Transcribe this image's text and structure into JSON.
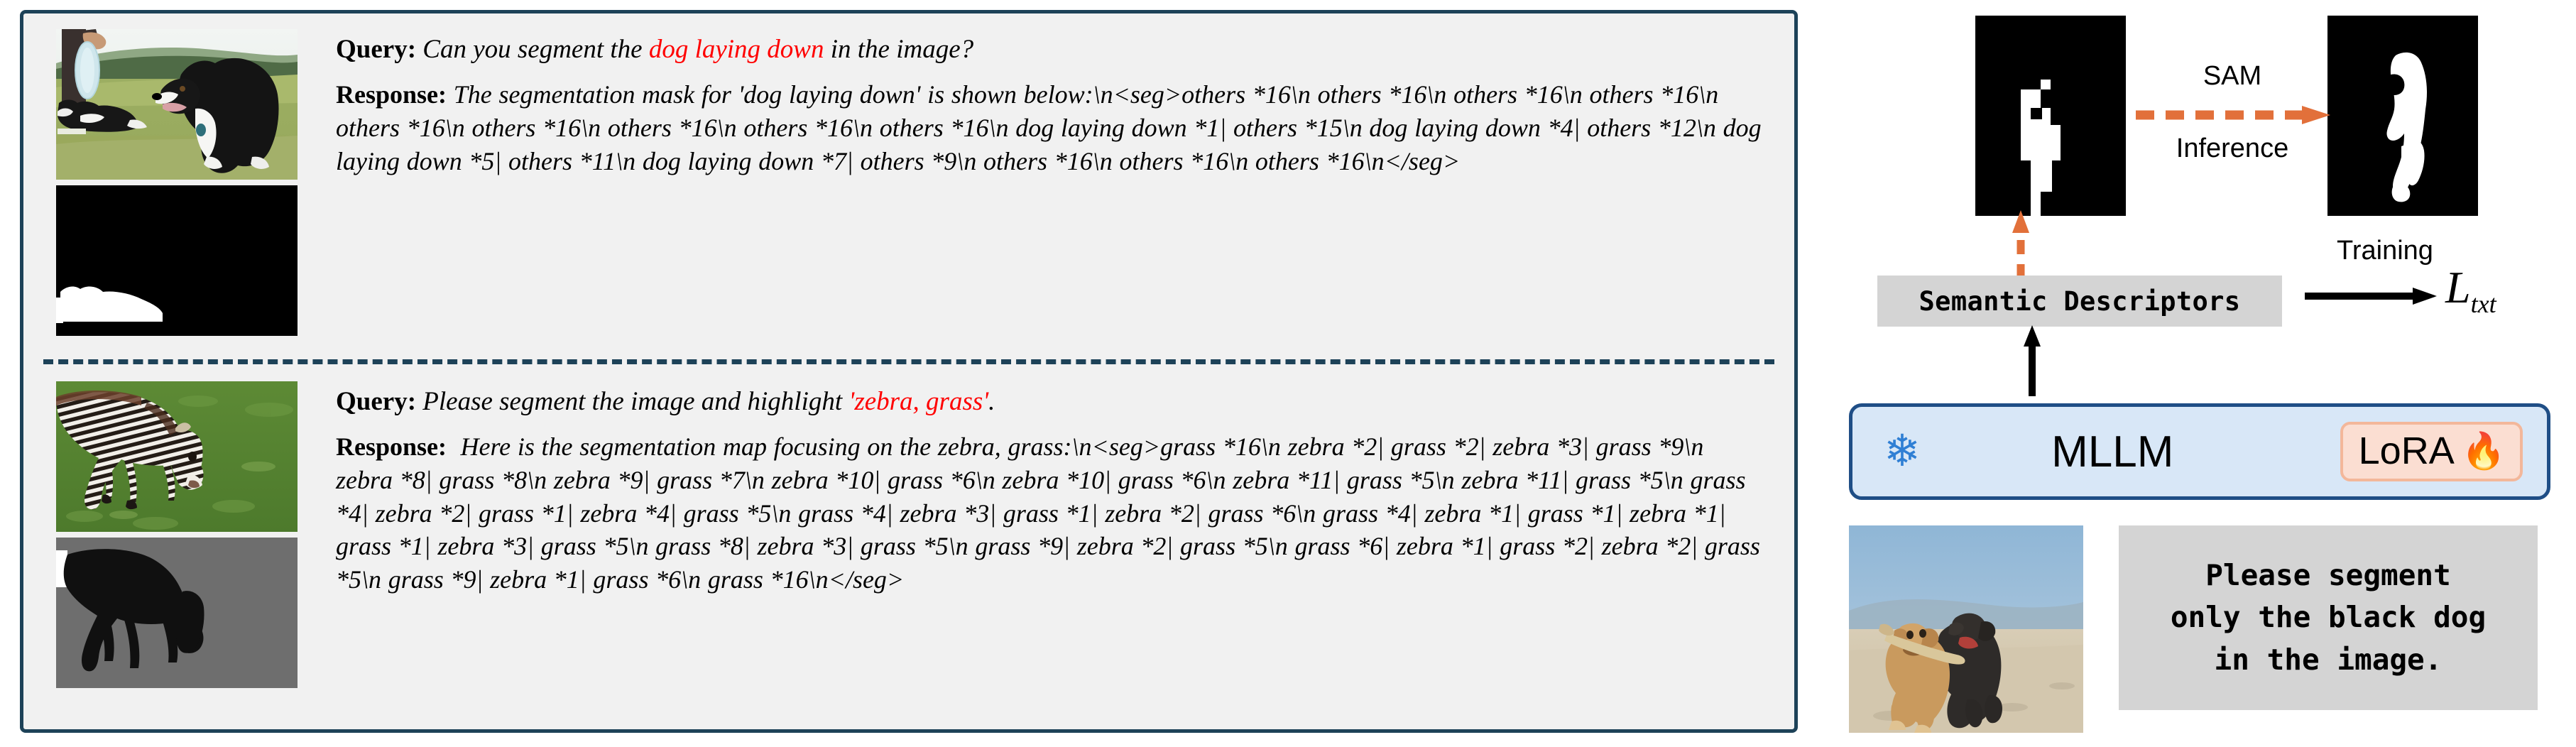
{
  "examples": [
    {
      "query_label": "Query",
      "query_prefix": "Can you segment the ",
      "query_highlight": "dog laying down",
      "query_suffix": " in the image?",
      "response_label": "Response",
      "response_text": "The segmentation mask for 'dog laying down' is shown below:\\n<seg>others *16\\n others *16\\n others *16\\n others *16\\n others *16\\n others *16\\n others *16\\n others *16\\n others *16\\n dog laying down *1| others *15\\n dog laying down *4| others *12\\n dog laying down *5| others *11\\n dog laying down *7| others *9\\n others *16\\n others *16\\n others *16\\n</seg>",
      "photo_alt": "border-collie-with-frisbee-photo",
      "mask_alt": "binary-mask-dog-laying-down"
    },
    {
      "query_label": "Query",
      "query_prefix": "Please segment the image and highlight ",
      "query_highlight": "'zebra, grass'",
      "query_suffix": ".",
      "response_label": "Response",
      "response_text": "Here is the segmentation map focusing on the zebra, grass:\\n<seg>grass *16\\n zebra *2| grass *2| zebra *3| grass *9\\n zebra *8| grass *8\\n zebra *9| grass *7\\n zebra *10| grass *6\\n zebra *10| grass *6\\n zebra *11| grass *5\\n zebra *11| grass *5\\n grass *4| zebra *2| grass *1| zebra *4| grass *5\\n grass *4| zebra *3| grass *1| zebra *2| grass *6\\n grass *4| zebra *1| grass *1| zebra *1| grass *1| zebra *3| grass *5\\n grass *8| zebra *3| grass *5\\n grass *9| zebra *2| grass *5\\n grass *6| zebra *1| grass *2| zebra *2| grass *5\\n grass *9| zebra *1| grass *6\\n grass *16\\n</seg>",
      "photo_alt": "zebra-grazing-photo",
      "mask_alt": "semantic-mask-zebra-grass"
    }
  ],
  "pipeline": {
    "sam_label": "SAM",
    "inference_label": "Inference",
    "training_label": "Training",
    "loss_symbol": "L",
    "loss_subscript": "txt",
    "semantic_descriptors_label": "Semantic Descriptors",
    "mllm_label": "MLLM",
    "lora_label": "LoRA",
    "snowflake_icon": "snowflake-icon",
    "fire_icon": "fire-icon",
    "prompt_text": "Please segment\nonly the black dog\nin the image.",
    "coarse_mask_alt": "coarse-token-mask",
    "sam_mask_alt": "refined-sam-mask",
    "input_photo_alt": "two-dogs-running-on-beach-photo"
  },
  "colors": {
    "panel_border": "#1d4258",
    "panel_background": "#f1f1f1",
    "highlight_red": "#ff0000",
    "arrow_orange": "#e2703a",
    "mllm_border": "#1f4e86",
    "mllm_fill": "#d8e7f7",
    "lora_fill": "#fbded2",
    "lora_border": "#f3b79a",
    "gray_box": "#d4d4d4"
  }
}
